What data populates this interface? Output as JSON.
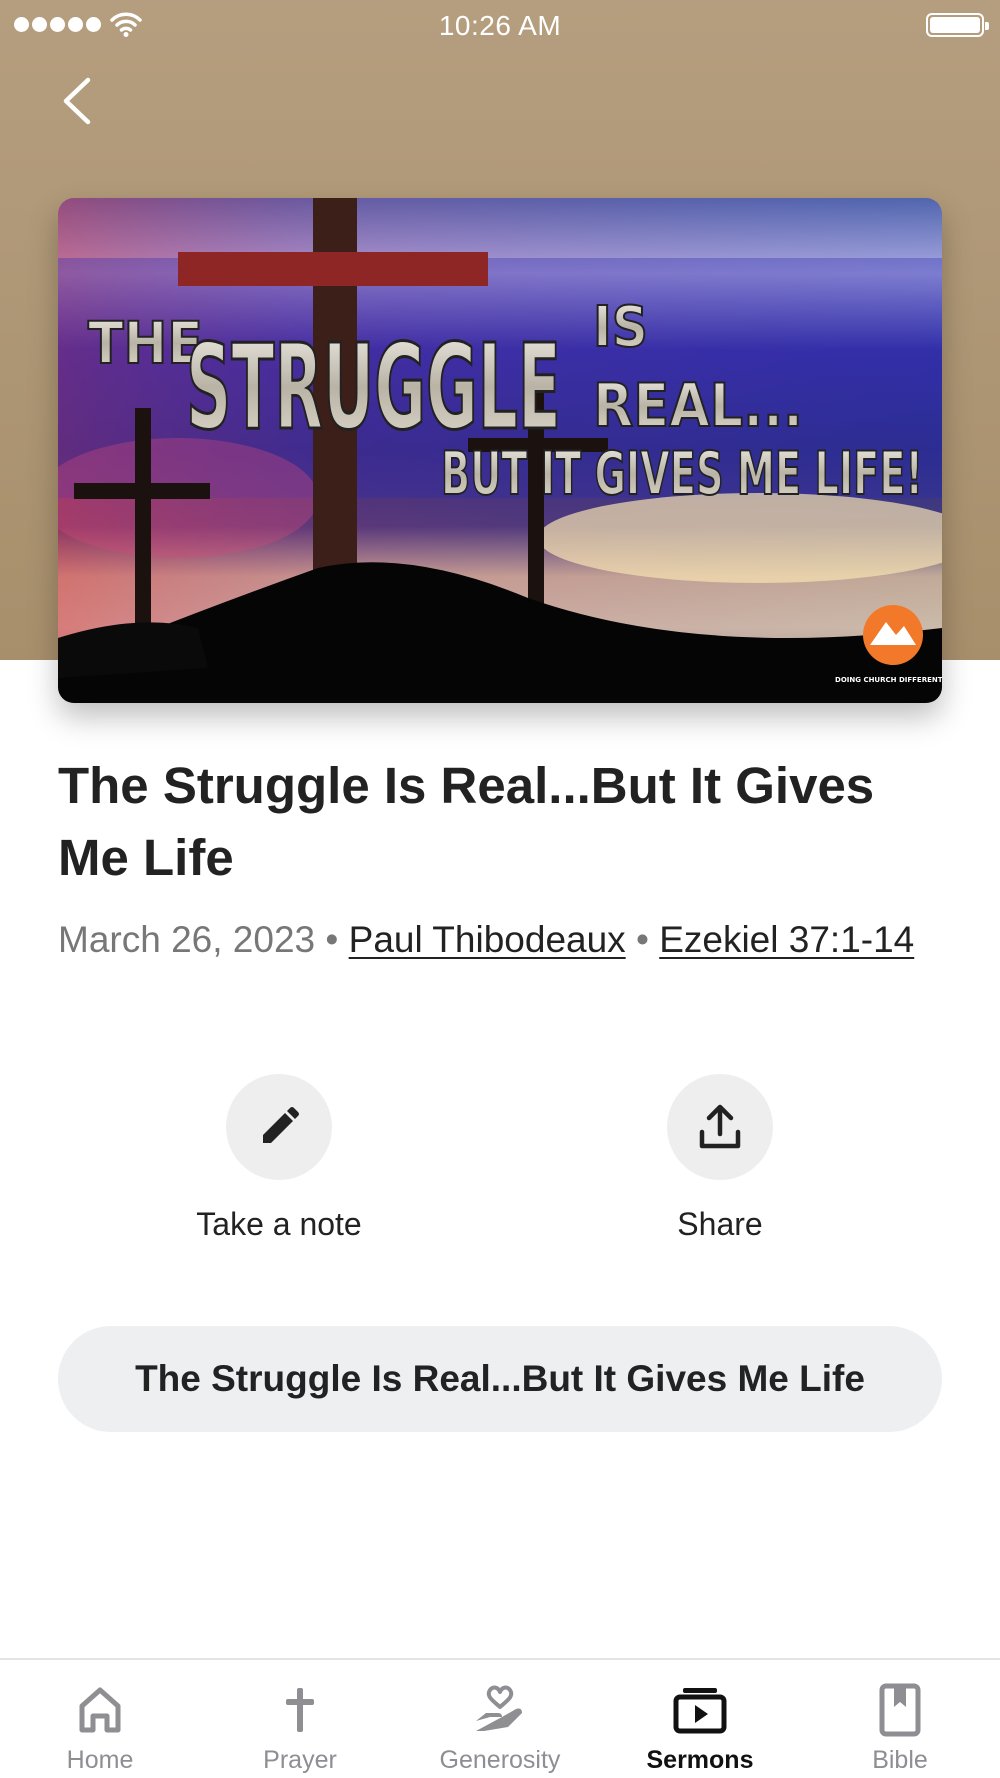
{
  "status_bar": {
    "time": "10:26 AM"
  },
  "artwork": {
    "text_line1_small": "THE",
    "text_line1_big": "STRUGGLE",
    "text_line1_is": "IS",
    "text_line2": "REAL...",
    "text_line3": "BUT IT GIVES ME LIFE!",
    "logo_text": "DOING CHURCH DIFFERENTLY",
    "logo_color": "#f2792a"
  },
  "sermon": {
    "title": "The Struggle Is Real...But It Gives Me Life",
    "date": "March 26, 2023",
    "separator": "•",
    "speaker": "Paul Thibodeaux",
    "scripture": "Ezekiel 37:1-14"
  },
  "actions": {
    "note_label": "Take a note",
    "share_label": "Share"
  },
  "media_pill": {
    "label": "The Struggle Is Real...But It Gives Me Life"
  },
  "tab_bar": {
    "tabs": [
      {
        "label": "Home",
        "icon": "home-icon"
      },
      {
        "label": "Prayer",
        "icon": "cross-icon"
      },
      {
        "label": "Generosity",
        "icon": "giving-hand-icon"
      },
      {
        "label": "Sermons",
        "icon": "play-stack-icon",
        "active": true
      },
      {
        "label": "Bible",
        "icon": "bookmark-book-icon"
      }
    ]
  },
  "colors": {
    "header_bg": "#ad9674",
    "accent": "#222222",
    "muted": "#8e8e93",
    "pill_bg": "#eeeff1"
  }
}
